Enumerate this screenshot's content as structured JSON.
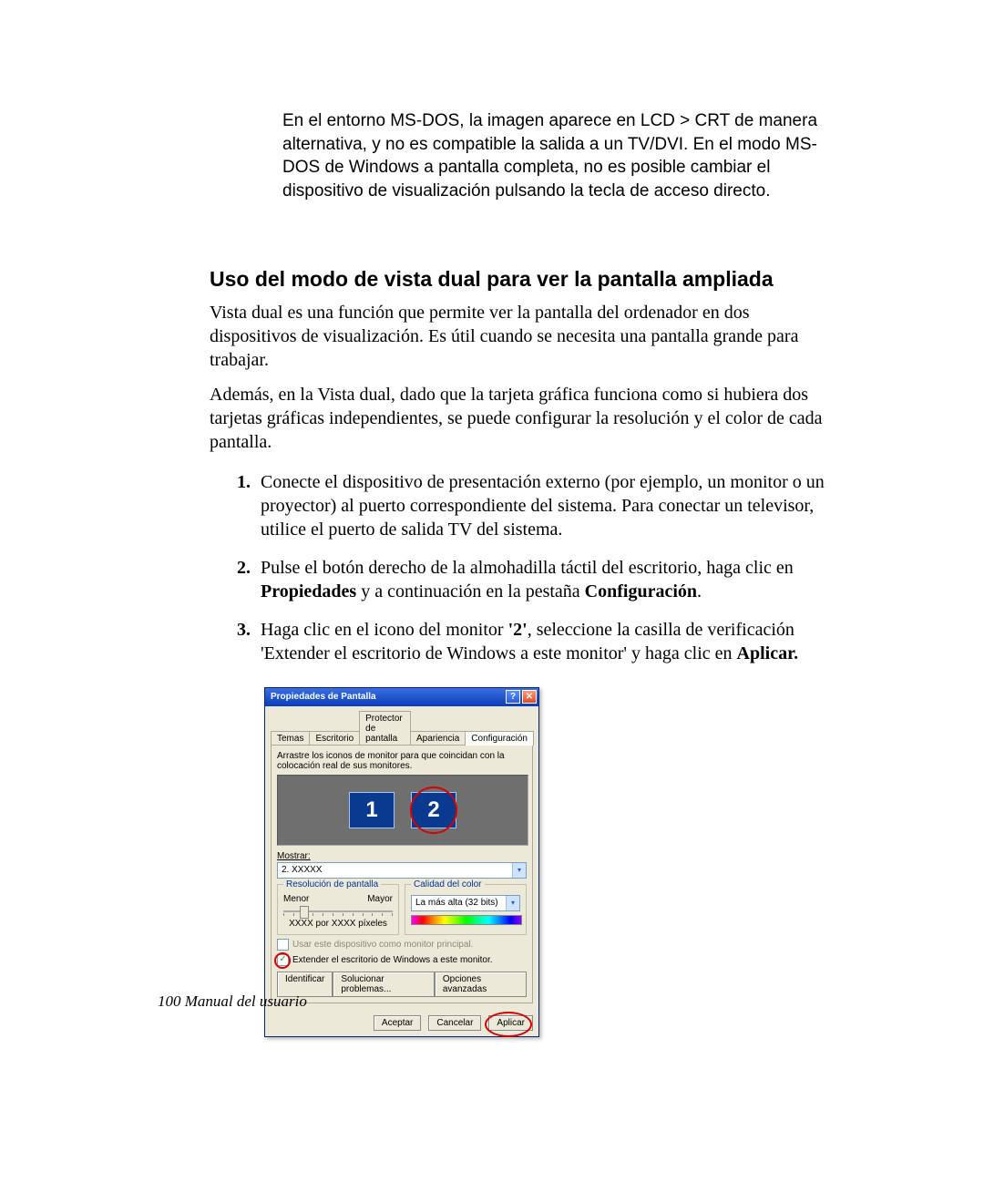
{
  "note": "En el entorno MS-DOS, la imagen aparece en LCD > CRT de manera alternativa, y no es compatible la salida a un TV/DVI. En el modo MS-DOS de Windows a pantalla completa, no es posible cambiar el dispositivo de visualización pulsando la tecla de acceso directo.",
  "heading": "Uso del modo de vista dual para ver la pantalla ampliada",
  "para1": "Vista dual es una función que permite ver la pantalla del ordenador en dos dispositivos de visualización. Es útil cuando se necesita una pantalla grande para trabajar.",
  "para2": "Además, en la Vista dual, dado que la tarjeta gráfica funciona como si hubiera dos tarjetas gráficas independientes, se puede configurar la resolución y el color de cada pantalla.",
  "steps": {
    "s1": "Conecte el dispositivo de presentación externo (por ejemplo, un monitor o un proyector) al puerto correspondiente del sistema. Para conectar un televisor, utilice el puerto de salida TV del sistema.",
    "s2a": "Pulse el botón derecho de la almohadilla táctil del escritorio, haga clic en ",
    "s2b_bold": "Propiedades",
    "s2c": " y a continuación en la pestaña ",
    "s2d_bold": "Configuración",
    "s2e": ".",
    "s3a": "Haga clic en el icono del monitor ",
    "s3b_bold": "'2'",
    "s3c": ", seleccione la casilla de verificación 'Extender el escritorio de Windows a este monitor' y haga clic en ",
    "s3d_bold": "Aplicar.",
    "s3e": ""
  },
  "dialog": {
    "title": "Propiedades de Pantalla",
    "help_icon": "?",
    "close_icon": "✕",
    "tabs": [
      "Temas",
      "Escritorio",
      "Protector de pantalla",
      "Apariencia",
      "Configuración"
    ],
    "active_tab_index": 4,
    "instruction": "Arrastre los iconos de monitor para que coincidan con la colocación real de sus monitores.",
    "monitor1": "1",
    "monitor2": "2",
    "mostrar_label": "Mostrar:",
    "mostrar_value": "2. XXXXX",
    "group_res": "Resolución de pantalla",
    "res_min": "Menor",
    "res_max": "Mayor",
    "res_value": "XXXX por XXXX píxeles",
    "group_color": "Calidad del color",
    "color_value": "La más alta (32 bits)",
    "chk_primary": "Usar este dispositivo como monitor principal.",
    "chk_extend": "Extender el escritorio de Windows a este monitor.",
    "btn_identify": "Identificar",
    "btn_trouble": "Solucionar problemas...",
    "btn_adv": "Opciones avanzadas",
    "btn_ok": "Aceptar",
    "btn_cancel": "Cancelar",
    "btn_apply": "Aplicar"
  },
  "footer": "100  Manual del usuario"
}
